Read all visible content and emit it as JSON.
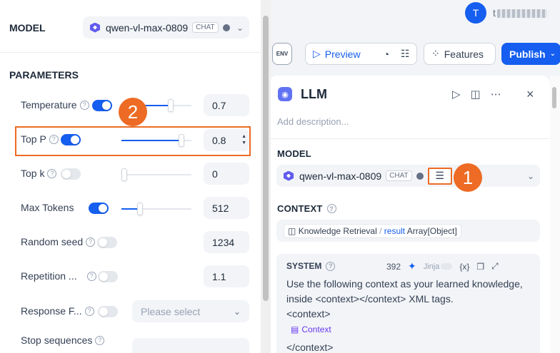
{
  "user": {
    "avatar_letter": "T",
    "name_visible": "t"
  },
  "toolbar": {
    "env_label": "ENV",
    "preview_label": "Preview",
    "features_label": "Features",
    "publish_label": "Publish"
  },
  "llm": {
    "title": "LLM",
    "description_placeholder": "Add description...",
    "model_section_label": "MODEL",
    "model_name": "qwen-vl-max-0809",
    "model_mode_badge": "CHAT",
    "context_label": "CONTEXT",
    "context_source": "Knowledge Retrieval",
    "context_sep": "/",
    "context_var": "result",
    "context_type": "Array[Object]",
    "system_label": "SYSTEM",
    "system_token_count": "392",
    "jinja_label": "Jinja",
    "var_icon_label": "{x}",
    "system_text_1": "Use the following context as your learned knowledge, inside <context></context> XML tags.",
    "system_text_2": "<context>",
    "system_context_var": "Context",
    "system_text_3": "</context>"
  },
  "params_panel": {
    "model_label": "MODEL",
    "model_name": "qwen-vl-max-0809",
    "model_mode_badge": "CHAT",
    "heading": "PARAMETERS",
    "rows": [
      {
        "label": "Temperature",
        "enabled": true,
        "value": "0.7",
        "slider_pct": 0.7
      },
      {
        "label": "Top P",
        "enabled": true,
        "value": "0.8",
        "slider_pct": 0.8
      },
      {
        "label": "Top k",
        "enabled": false,
        "value": "0",
        "slider_pct": 0
      },
      {
        "label": "Max Tokens",
        "enabled": true,
        "value": "512",
        "slider_pct": 0.25
      },
      {
        "label": "Random seed",
        "enabled": false,
        "value": "1234"
      },
      {
        "label": "Repetition ...",
        "enabled": false,
        "value": "1.1"
      },
      {
        "label": "Response F...",
        "enabled": false,
        "placeholder": "Please select"
      },
      {
        "label": "Stop sequences"
      }
    ]
  },
  "annotations": {
    "callout_1": "1",
    "callout_2": "2"
  },
  "colors": {
    "accent": "#155eef",
    "callout": "#ed6b24"
  }
}
